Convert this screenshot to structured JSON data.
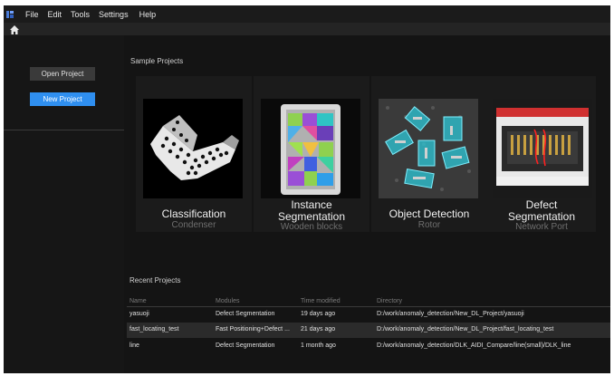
{
  "menubar": {
    "logo_icon": "app-logo-icon",
    "items": [
      "File",
      "Edit",
      "Tools",
      "Settings",
      "Help"
    ]
  },
  "toolbar": {
    "home_icon": "home-icon"
  },
  "sidebar": {
    "open_project": "Open Project",
    "new_project": "New Project"
  },
  "sample": {
    "title": "Sample Projects",
    "cards": [
      {
        "title": "Classification",
        "subtitle": "Condenser"
      },
      {
        "title": "Instance",
        "title2": "Segmentation",
        "subtitle": "Wooden blocks"
      },
      {
        "title": "Object Detection",
        "subtitle": "Rotor"
      },
      {
        "title": "Defect",
        "title2": "Segmentation",
        "subtitle": "Network Port"
      }
    ]
  },
  "recent": {
    "title": "Recent Projects",
    "columns": [
      "Name",
      "Modules",
      "Time modified",
      "Directory"
    ],
    "rows": [
      {
        "name": "yasuoji",
        "modules": "Defect Segmentation",
        "time": "19 days ago",
        "directory": "D:/work/anomaly_detection/New_DL_Project/yasuoji"
      },
      {
        "name": "fast_locating_test",
        "modules": "Fast Positioning+Defect ...",
        "time": "21 days ago",
        "directory": "D:/work/anomaly_detection/New_DL_Project/fast_locating_test"
      },
      {
        "name": "line",
        "modules": "Defect Segmentation",
        "time": "1 month ago",
        "directory": "D:/work/anomaly_detection/DLK_AIDI_Compare/line(small)/DLK_line"
      }
    ]
  },
  "colors": {
    "accent": "#2f8ff0",
    "background": "#141414",
    "panel": "#1b1b1b"
  }
}
